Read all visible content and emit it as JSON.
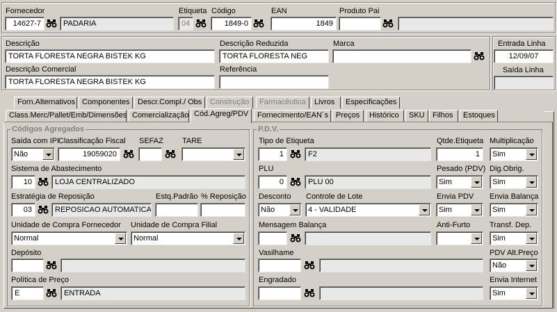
{
  "header": {
    "fornecedor_label": "Fornecedor",
    "fornecedor_code": "14627-7",
    "fornecedor_name": "PADARIA",
    "etiqueta_label": "Etiqueta",
    "etiqueta_value": "04",
    "codigo_label": "Código",
    "codigo_value": "1849-0",
    "ean_label": "EAN",
    "ean_value": "1849",
    "produto_pai_label": "Produto Pai",
    "produto_pai_value": "",
    "produto_pai_desc": ""
  },
  "descricao": {
    "descricao_label": "Descrição",
    "descricao_value": "TORTA FLORESTA NEGRA BISTEK KG",
    "reduzida_label": "Descrição Reduzida",
    "reduzida_value": "TORTA FLORESTA NEG",
    "marca_label": "Marca",
    "marca_value": "",
    "comercial_label": "Descrição Comercial",
    "comercial_value": "TORTA FLORESTA NEGRA BISTEK KG",
    "referencia_label": "Referência",
    "referencia_value": "",
    "entrada_linha_label": "Entrada Linha",
    "entrada_linha_value": "12/09/07",
    "saida_linha_label": "Saída Linha",
    "saida_linha_value": ""
  },
  "tabs_row1": [
    "Forn.Alternativos",
    "Componentes",
    "Descr.Compl./ Obs",
    "Construção",
    "Farmacêutica",
    "Livros",
    "Especificações"
  ],
  "tabs_row2": [
    "Class.Merc/Pallet/Emb/Dimensões",
    "Comercialização",
    "Cód.Agreg/PDV",
    "Fornecimento/EAN´s",
    "Preços",
    "Histórico",
    "SKU",
    "Filhos",
    "Estoques"
  ],
  "codigos": {
    "title": "Códigos Agregados",
    "saida_ipi_label": "Saída com IPI",
    "saida_ipi_value": "Não",
    "class_fiscal_label": "Classificação Fiscal",
    "class_fiscal_value": "19059020",
    "sefaz_label": "SEFAZ",
    "sefaz_value": "",
    "tare_label": "TARE",
    "tare_value": "",
    "sist_abast_label": "Sistema de Abastecimento",
    "sist_abast_code": "10",
    "sist_abast_desc": "LOJA CENTRALIZADO",
    "estrategia_label": "Estratégia de Reposição",
    "estrategia_code": "03",
    "estrategia_desc": "REPOSICAO AUTOMATICA",
    "estq_padrao_label": "Estq.Padrão",
    "estq_padrao_value": "",
    "perc_repos_label": "% Reposição",
    "perc_repos_value": "",
    "un_compra_forn_label": "Unidade de Compra Fornecedor",
    "un_compra_forn_value": "Normal",
    "un_compra_filial_label": "Unidade de Compra Filial",
    "un_compra_filial_value": "Normal",
    "deposito_label": "Depósito",
    "deposito_code": "",
    "deposito_desc": "",
    "politica_label": "Política de Preço",
    "politica_code": "E",
    "politica_desc": "ENTRADA"
  },
  "pdv": {
    "title": "P.D.V.",
    "tipo_etiq_label": "Tipo de Etiqueta",
    "tipo_etiq_code": "1",
    "tipo_etiq_desc": "F2",
    "qtde_etiq_label": "Qtde.Etiqueta",
    "qtde_etiq_value": "1",
    "multiplicacao_label": "Multiplicação",
    "multiplicacao_value": "Sim",
    "plu_label": "PLU",
    "plu_code": "0",
    "plu_desc": "PLU 00",
    "pesado_label": "Pesado (PDV)",
    "pesado_value": "Sim",
    "dig_obrig_label": "Dig.Obrig.",
    "dig_obrig_value": "Sim",
    "desconto_label": "Desconto",
    "desconto_value": "Não",
    "controle_lote_label": "Controle de Lote",
    "controle_lote_value": "4 - VALIDADE",
    "envia_pdv_label": "Envia PDV",
    "envia_pdv_value": "Sim",
    "envia_balanca_label": "Envia Balança",
    "envia_balanca_value": "Sim",
    "msg_balanca_label": "Mensagem Balança",
    "msg_balanca_code": "",
    "msg_balanca_desc": "",
    "anti_furto_label": "Anti-Furto",
    "anti_furto_value": "",
    "transf_dep_label": "Transf. Dep.",
    "transf_dep_value": "Sim",
    "vasilhame_label": "Vasilhame",
    "vasilhame_code": "",
    "vasilhame_desc": "",
    "pdv_alt_preco_label": "PDV Alt.Preço",
    "pdv_alt_preco_value": "Não",
    "engradado_label": "Engradado",
    "engradado_code": "",
    "engradado_desc": "",
    "envia_internet_label": "Envia Internet",
    "envia_internet_value": "Sim"
  }
}
